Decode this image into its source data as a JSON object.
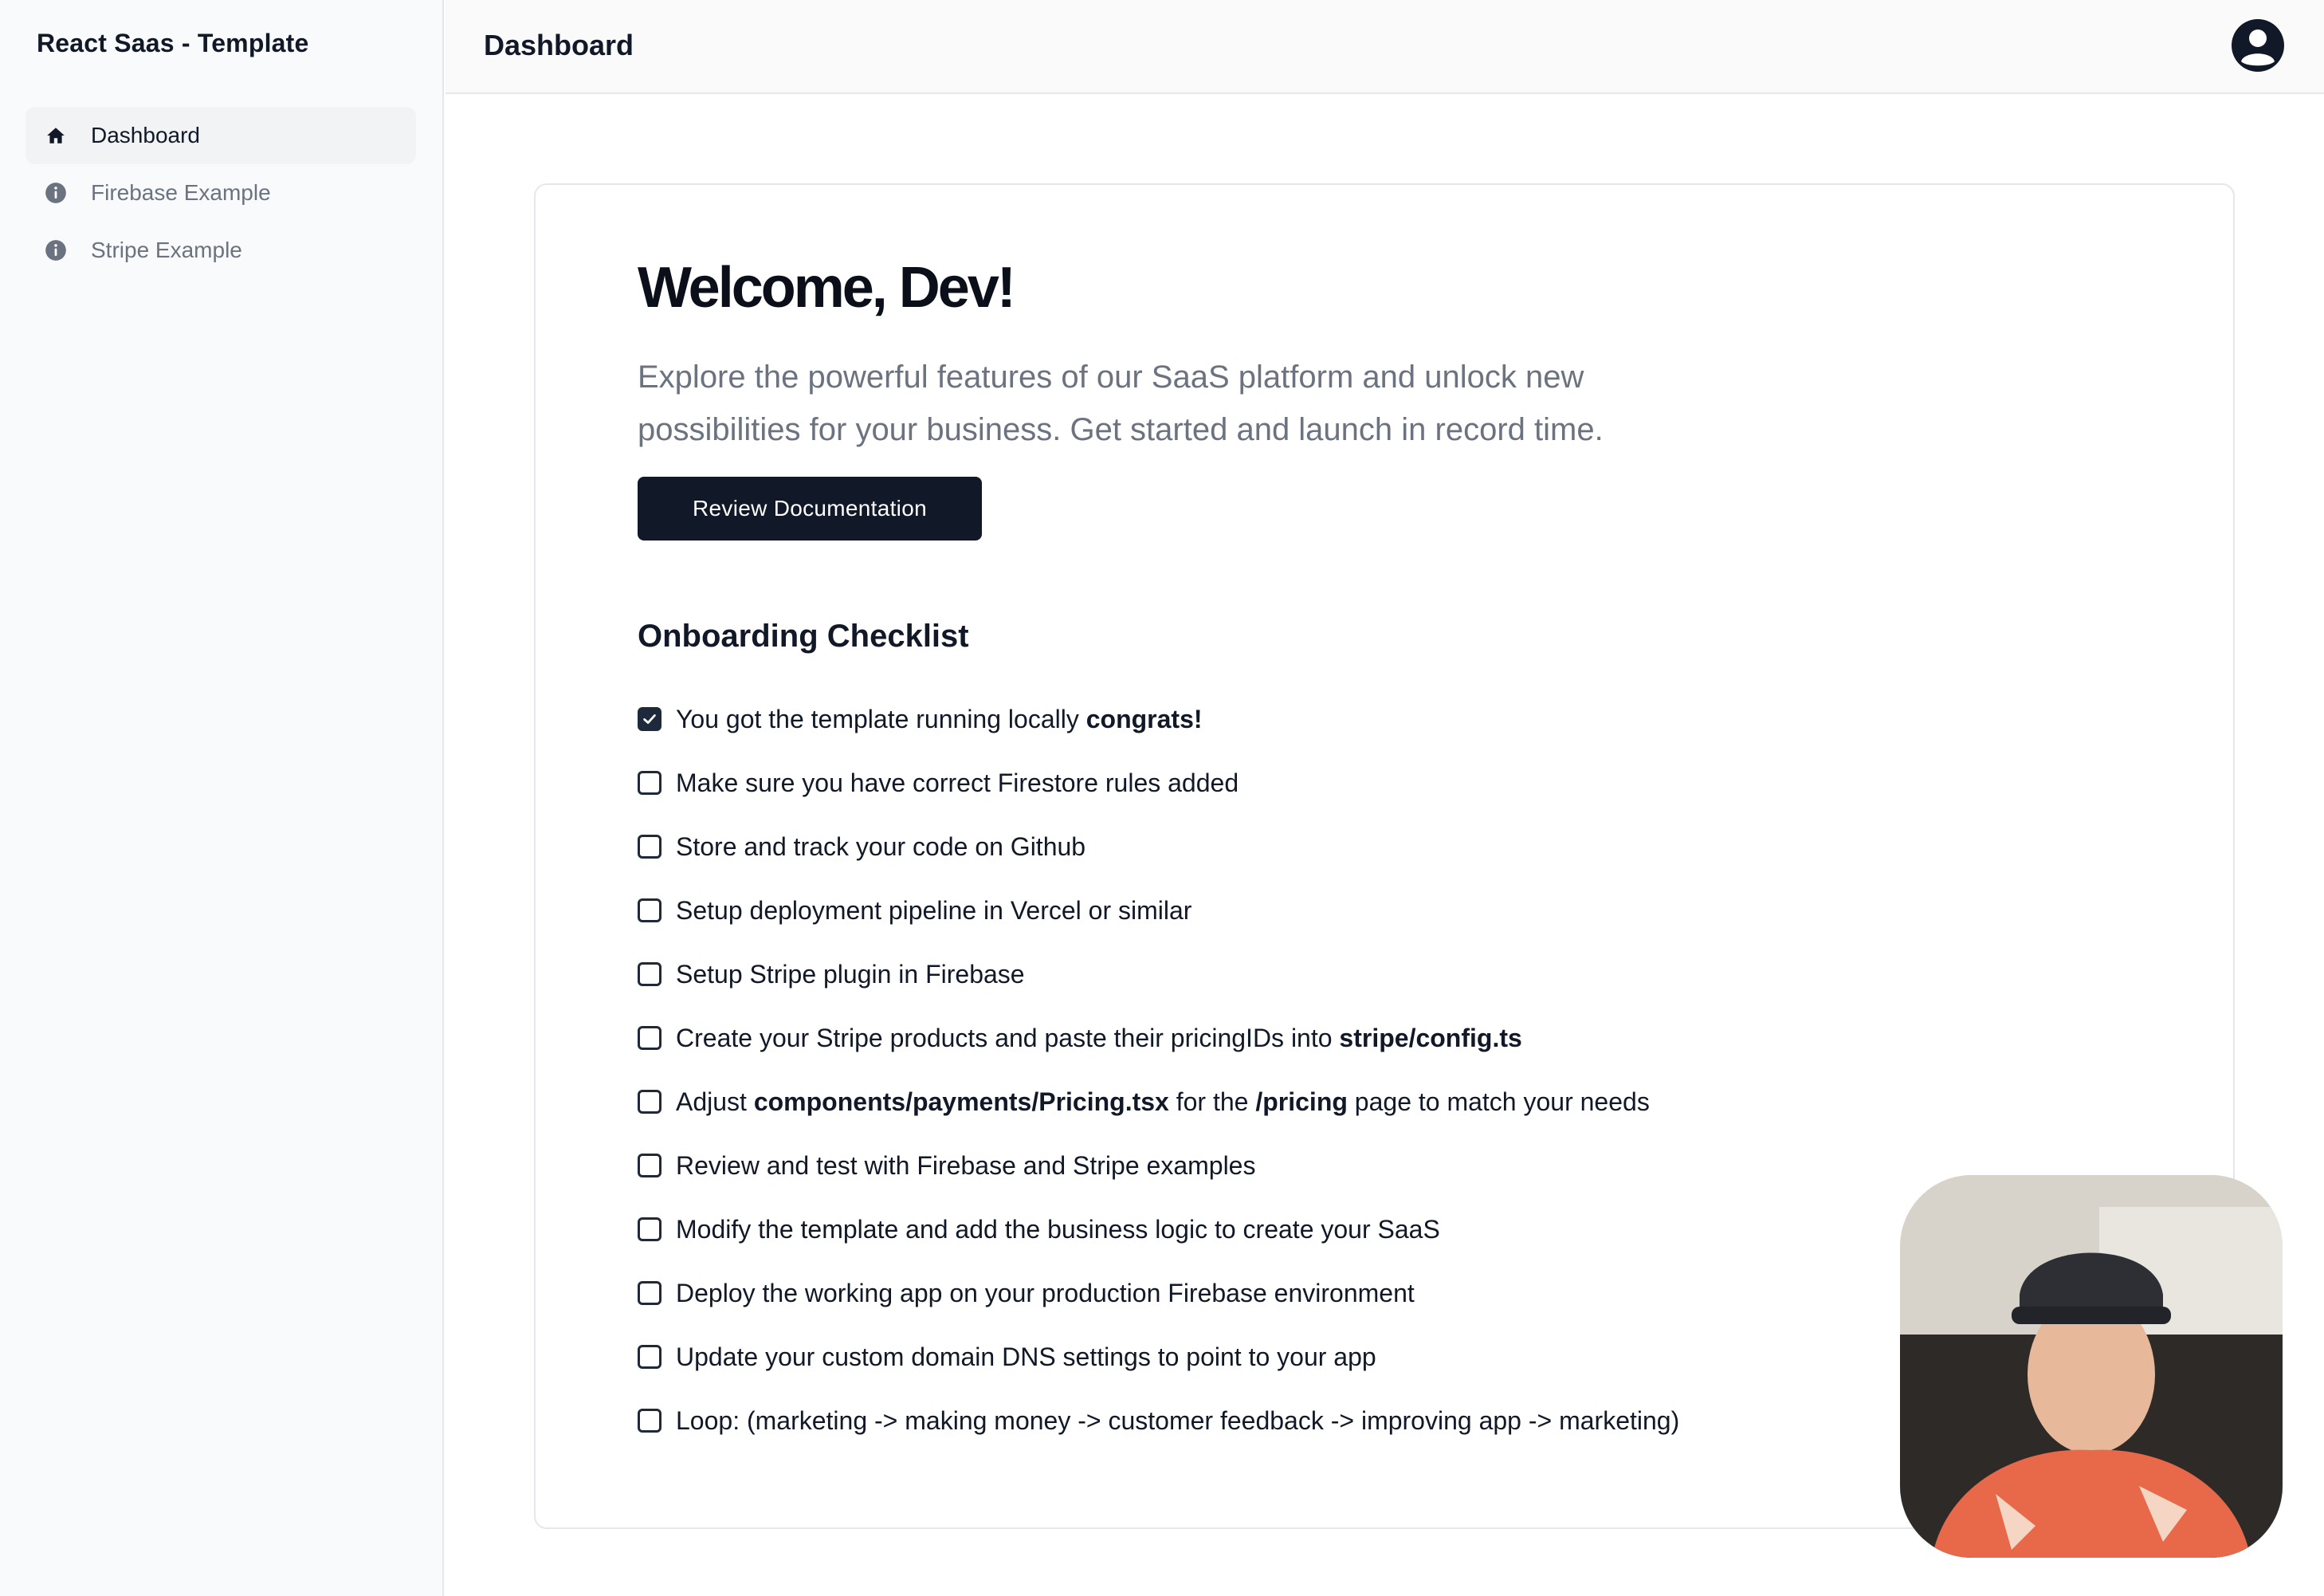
{
  "sidebar": {
    "brand": "React Saas - Template",
    "items": [
      {
        "label": "Dashboard",
        "icon": "home-icon",
        "active": true
      },
      {
        "label": "Firebase Example",
        "icon": "info-icon",
        "active": false
      },
      {
        "label": "Stripe Example",
        "icon": "info-icon",
        "active": false
      }
    ]
  },
  "header": {
    "title": "Dashboard",
    "avatar_icon": "user-circle-icon"
  },
  "main": {
    "welcome": "Welcome, Dev!",
    "subtitle_line1": "Explore the powerful features of our SaaS platform and unlock new",
    "subtitle_line2": "possibilities for your business. Get started and launch in record time.",
    "cta_label": "Review Documentation",
    "checklist_title": "Onboarding Checklist",
    "checklist": [
      {
        "checked": true,
        "parts": [
          {
            "t": "You got the template running locally "
          },
          {
            "t": "congrats!",
            "b": true
          }
        ]
      },
      {
        "checked": false,
        "parts": [
          {
            "t": "Make sure you have correct Firestore rules added"
          }
        ]
      },
      {
        "checked": false,
        "parts": [
          {
            "t": "Store and track your code on Github"
          }
        ]
      },
      {
        "checked": false,
        "parts": [
          {
            "t": "Setup deployment pipeline in Vercel or similar"
          }
        ]
      },
      {
        "checked": false,
        "parts": [
          {
            "t": "Setup Stripe plugin in Firebase"
          }
        ]
      },
      {
        "checked": false,
        "parts": [
          {
            "t": "Create your Stripe products and paste their pricingIDs into "
          },
          {
            "t": "stripe/config.ts",
            "b": true
          }
        ]
      },
      {
        "checked": false,
        "parts": [
          {
            "t": "Adjust "
          },
          {
            "t": "components/payments/Pricing.tsx",
            "b": true
          },
          {
            "t": " for the "
          },
          {
            "t": "/pricing",
            "b": true
          },
          {
            "t": " page to match your needs"
          }
        ]
      },
      {
        "checked": false,
        "parts": [
          {
            "t": "Review and test with Firebase and Stripe examples"
          }
        ]
      },
      {
        "checked": false,
        "parts": [
          {
            "t": "Modify the template and add the business logic to create your SaaS"
          }
        ]
      },
      {
        "checked": false,
        "parts": [
          {
            "t": "Deploy the working app on your production Firebase environment"
          }
        ]
      },
      {
        "checked": false,
        "parts": [
          {
            "t": "Update your custom domain DNS settings to point to your app"
          }
        ]
      },
      {
        "checked": false,
        "parts": [
          {
            "t": "Loop: (marketing -> making money -> customer feedback -> improving app -> marketing)"
          }
        ]
      }
    ]
  },
  "colors": {
    "primary_button": "#111827",
    "sidebar_bg": "#f9fafb",
    "muted_text": "#6b7280"
  }
}
